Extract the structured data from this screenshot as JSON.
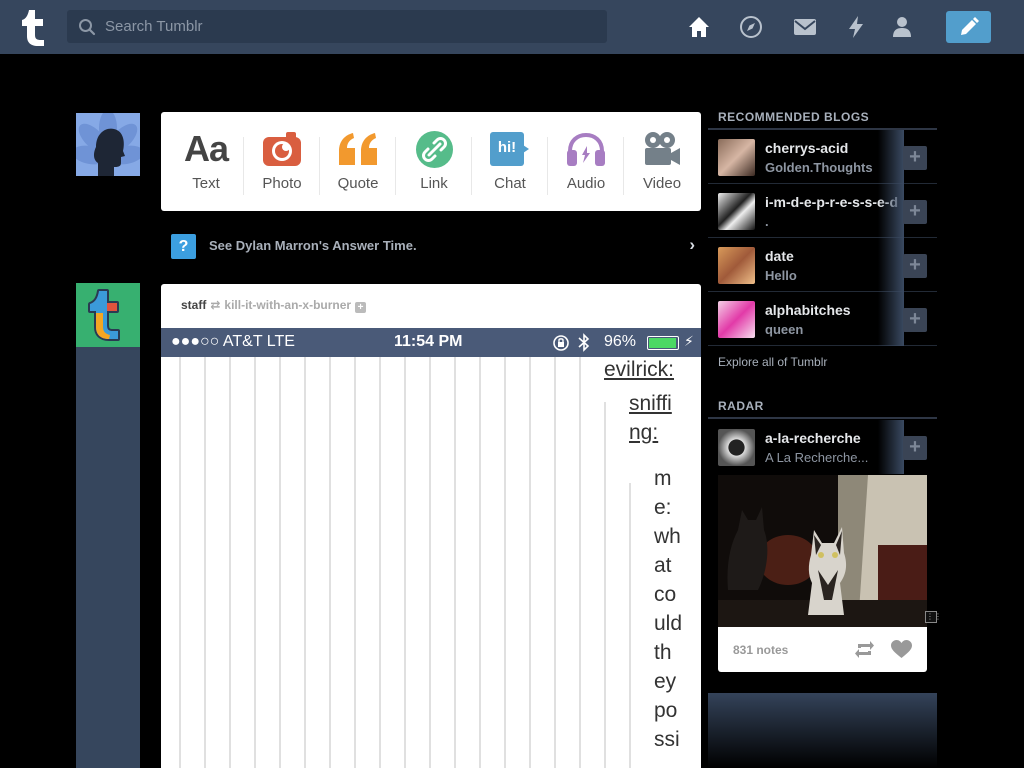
{
  "header": {
    "search_placeholder": "Search Tumblr",
    "accent": "#36465d",
    "compose_color": "#529ecc",
    "nav_icons": [
      "home-icon",
      "explore-icon",
      "inbox-icon",
      "activity-icon",
      "account-icon"
    ]
  },
  "post_types": [
    {
      "label": "Text",
      "icon": "text-icon",
      "color": "#444444"
    },
    {
      "label": "Photo",
      "icon": "camera-icon",
      "color": "#d95e40"
    },
    {
      "label": "Quote",
      "icon": "quote-icon",
      "color": "#f2992e"
    },
    {
      "label": "Link",
      "icon": "link-icon",
      "color": "#56bc8a"
    },
    {
      "label": "Chat",
      "icon": "chat-icon",
      "color": "#529ecc"
    },
    {
      "label": "Audio",
      "icon": "headphones-icon",
      "color": "#a77dc2"
    },
    {
      "label": "Video",
      "icon": "video-camera-icon",
      "color": "#748089"
    }
  ],
  "text_glyph": "Aa",
  "chat_glyph": "hi!",
  "answer_time": {
    "text": "See Dylan Marron's Answer Time.",
    "icon_glyph": "?"
  },
  "post": {
    "author": "staff",
    "source": "kill-it-with-an-x-burner",
    "phone": {
      "carrier": "●●●○○ AT&T  LTE",
      "time": "11:54 PM",
      "battery": "96%",
      "battery_level": 0.96
    },
    "lines": [
      "evilrick:",
      "sniffi",
      "ng:",
      "m",
      "e:",
      "wh",
      "at",
      "co",
      "uld",
      "th",
      "ey",
      "po",
      "ssi"
    ]
  },
  "sidebar": {
    "recommended_title": "RECOMMENDED BLOGS",
    "blogs": [
      {
        "name": "cherrys-acid",
        "subtitle": "Golden.Thoughts"
      },
      {
        "name": "i-m-d-e-p-r-e-s-s-e-d",
        "subtitle": "."
      },
      {
        "name": "date",
        "subtitle": "Hello"
      },
      {
        "name": "alphabitches",
        "subtitle": "queen"
      }
    ],
    "explore": "Explore all of Tumblr",
    "radar_title": "RADAR",
    "radar": {
      "name": "a-la-recherche",
      "subtitle": "A La Recherche...",
      "notes": "831 notes"
    }
  }
}
